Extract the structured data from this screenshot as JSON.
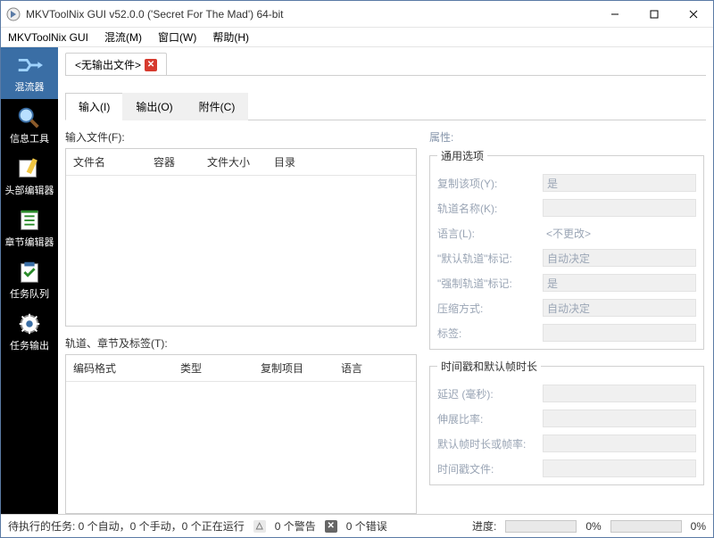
{
  "window": {
    "title": "MKVToolNix GUI v52.0.0 ('Secret For The Mad') 64-bit"
  },
  "menubar": {
    "app": "MKVToolNix GUI",
    "mux": "混流(M)",
    "window": "窗口(W)",
    "help": "帮助(H)"
  },
  "sidebar": {
    "muxer": "混流器",
    "info": "信息工具",
    "header_editor": "头部编辑器",
    "chapter_editor": "章节编辑器",
    "job_queue": "任务队列",
    "job_output": "任务输出"
  },
  "doc_tab": {
    "label": "<无输出文件>"
  },
  "tabs": {
    "input": "输入(I)",
    "output": "输出(O)",
    "attachments": "附件(C)"
  },
  "labels": {
    "input_files": "输入文件(F):",
    "properties": "属性:",
    "tracks": "轨道、章节及标签(T):"
  },
  "files_columns": {
    "name": "文件名",
    "container": "容器",
    "size": "文件大小",
    "dir": "目录"
  },
  "tracks_columns": {
    "codec": "编码格式",
    "type": "类型",
    "copy": "复制项目",
    "lang": "语言"
  },
  "general_options": {
    "legend": "通用选项",
    "copy_item_k": "复制该项(Y):",
    "copy_item_v": "是",
    "track_name_k": "轨道名称(K):",
    "track_name_v": "",
    "language_k": "语言(L):",
    "language_v": "<不更改>",
    "default_flag_k": "\"默认轨道\"标记:",
    "default_flag_v": "自动决定",
    "forced_flag_k": "\"强制轨道\"标记:",
    "forced_flag_v": "是",
    "compression_k": "压缩方式:",
    "compression_v": "自动决定",
    "tags_k": "标签:",
    "tags_v": ""
  },
  "timing": {
    "legend": "时间戳和默认帧时长",
    "delay_k": "延迟 (毫秒):",
    "stretch_k": "伸展比率:",
    "default_dur_k": "默认帧时长或帧率:",
    "ts_file_k": "时间戳文件:"
  },
  "statusbar": {
    "pending": "待执行的任务: 0 个自动，0 个手动，0 个正在运行",
    "warnings": "0 个警告",
    "errors": "0 个错误",
    "progress": "进度:",
    "pct": "0%"
  }
}
